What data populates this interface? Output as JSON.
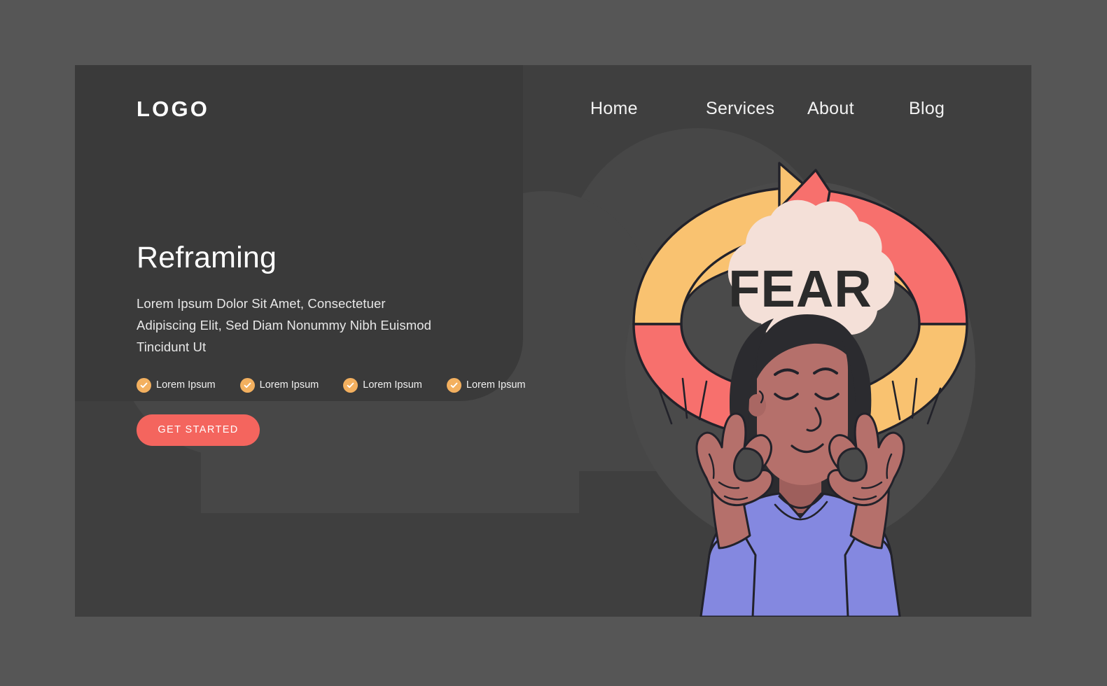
{
  "page": {
    "background_color": "#565656",
    "panel_color": "#3f3f3f",
    "plate_color": "#3a3a3a"
  },
  "header": {
    "logo": "LOGO",
    "nav": [
      {
        "label": "Home"
      },
      {
        "label": "Services"
      },
      {
        "label": "About"
      },
      {
        "label": "Blog"
      }
    ]
  },
  "hero": {
    "title": "Reframing",
    "subtitle": "Lorem Ipsum Dolor Sit Amet, Consectetuer Adipiscing Elit, Sed Diam Nonummy Nibh Euismod Tincidunt Ut",
    "features": [
      {
        "label": "Lorem Ipsum",
        "icon": "check-circle-icon"
      },
      {
        "label": "Lorem Ipsum",
        "icon": "check-circle-icon"
      },
      {
        "label": "Lorem Ipsum",
        "icon": "check-circle-icon"
      },
      {
        "label": "Lorem Ipsum",
        "icon": "check-circle-icon"
      }
    ],
    "cta_label": "GET STARTED"
  },
  "illustration": {
    "bubble_text": "FEAR",
    "colors": {
      "arrow_yellow": "#f9c270",
      "arrow_red": "#f7706d",
      "cloud_bubble": "#f4e0d8",
      "shirt": "#8488e0",
      "skin": "#b5706b",
      "hair": "#2b2b2f",
      "outline": "#1f1f25",
      "backdrop_blob": "#4a4a4a",
      "bg_cloud": "#474747"
    },
    "accent_colors": {
      "check": "#f3b05f",
      "cta": "#f4655e"
    }
  }
}
